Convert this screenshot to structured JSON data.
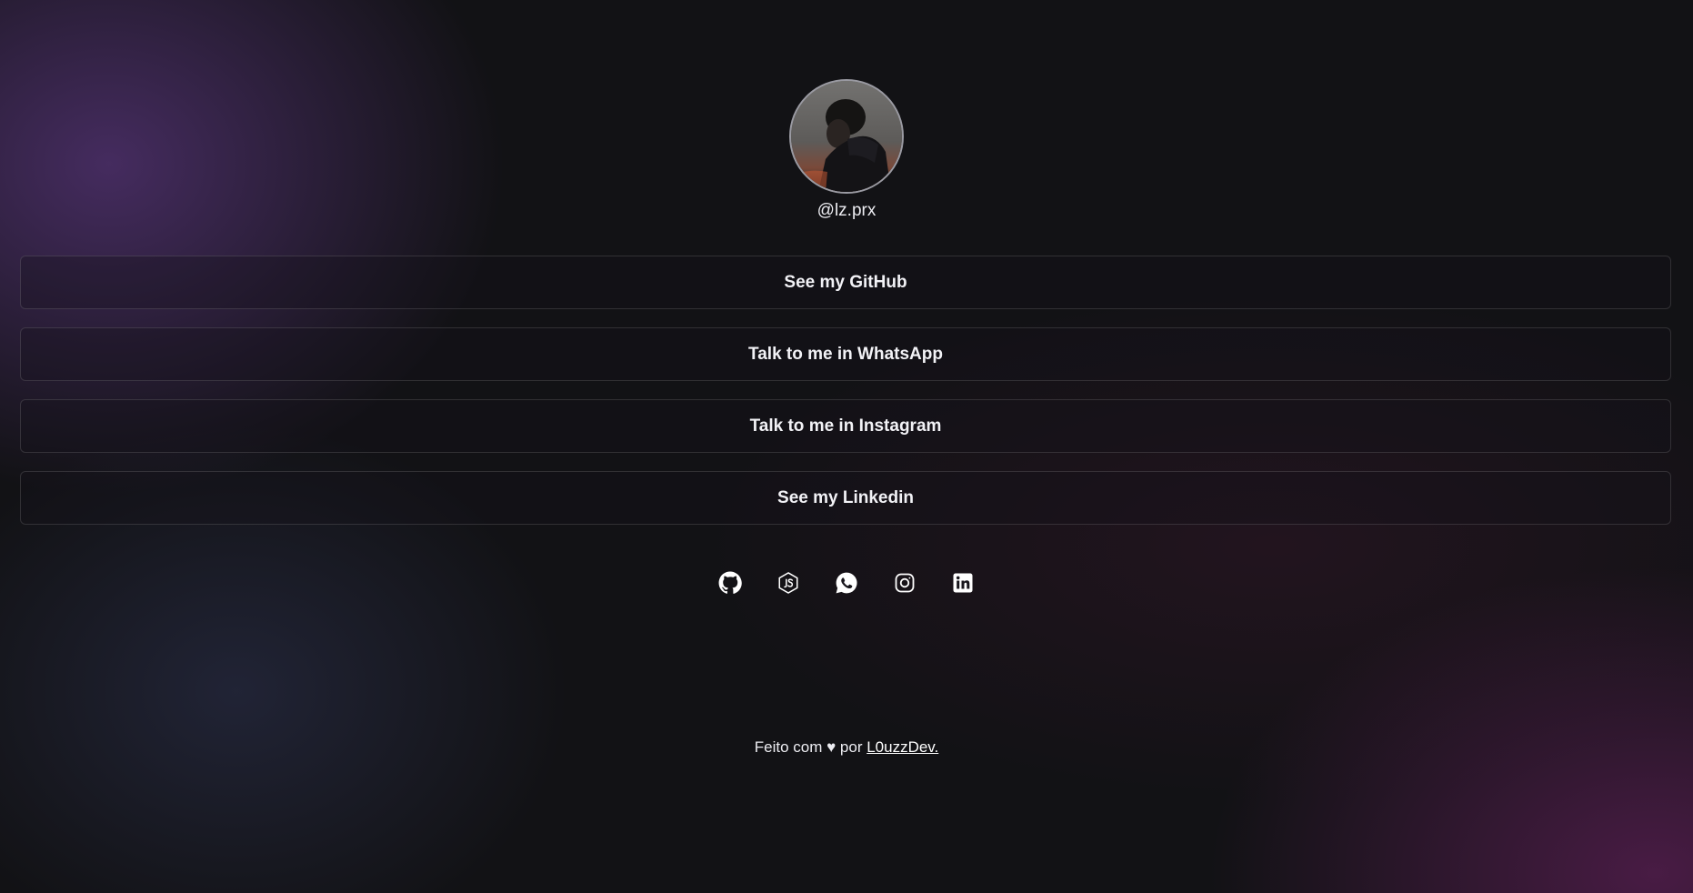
{
  "profile": {
    "handle": "@lz.prx"
  },
  "links": [
    {
      "label": "See my GitHub"
    },
    {
      "label": "Talk to me in WhatsApp"
    },
    {
      "label": "Talk to me in Instagram"
    },
    {
      "label": "See my Linkedin"
    }
  ],
  "socials": [
    {
      "icon": "github-icon"
    },
    {
      "icon": "nodejs-icon"
    },
    {
      "icon": "whatsapp-icon"
    },
    {
      "icon": "instagram-icon"
    },
    {
      "icon": "linkedin-icon"
    }
  ],
  "footer": {
    "prefix": "Feito com ♥ por ",
    "author": "L0uzzDev."
  },
  "colors": {
    "background": "#121215",
    "accent_purple": "#4e306c",
    "accent_magenta": "#561e50",
    "text": "#ececf1"
  }
}
